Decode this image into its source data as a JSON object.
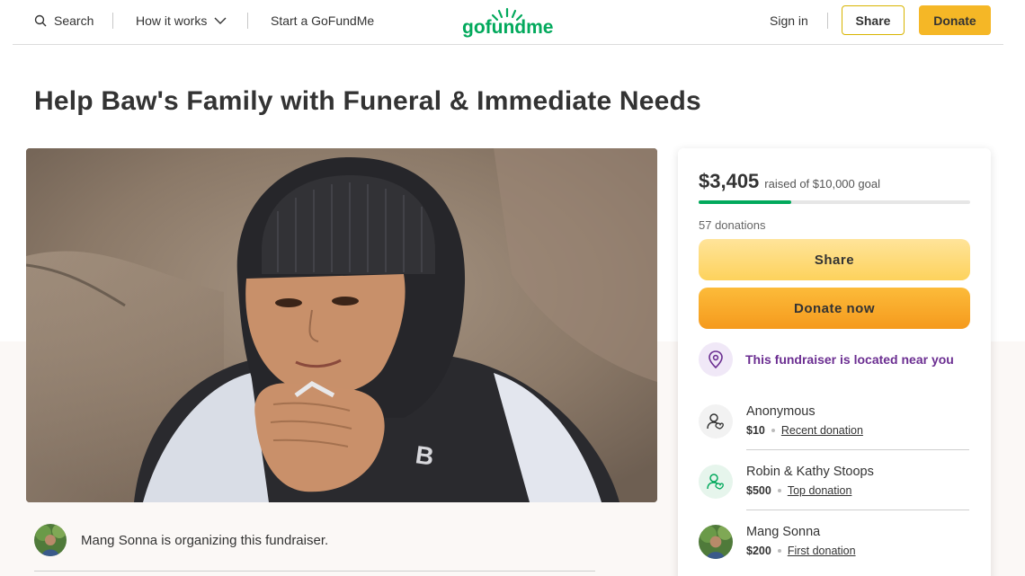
{
  "header": {
    "search_label": "Search",
    "how_it_works_label": "How it works",
    "start_label": "Start a GoFundMe",
    "logo_text": "gofundme",
    "sign_in_label": "Sign in",
    "share_label": "Share",
    "donate_label": "Donate"
  },
  "page_title": "Help Baw's Family with Funeral & Immediate Needs",
  "organizer": {
    "text": "Mang Sonna is organizing this fundraiser."
  },
  "donation_card": {
    "raised_amount": "$3,405",
    "raised_goal_text": "raised of $10,000 goal",
    "progress_fraction": 0.34,
    "donations_count": "57 donations",
    "share_label": "Share",
    "donate_now_label": "Donate now",
    "nearby_text": "This fundraiser is located near you",
    "donors": [
      {
        "name": "Anonymous",
        "amount": "$10",
        "tag": "Recent donation",
        "icon": "donor-icon"
      },
      {
        "name": "Robin & Kathy Stoops",
        "amount": "$500",
        "tag": "Top donation",
        "icon": "donor-icon-green"
      },
      {
        "name": "Mang Sonna",
        "amount": "$200",
        "tag": "First donation",
        "icon": "avatar-photo"
      }
    ]
  },
  "colors": {
    "brand_green": "#02a95c",
    "donate_yellow": "#f5b726",
    "nearby_purple": "#6b2e91"
  }
}
